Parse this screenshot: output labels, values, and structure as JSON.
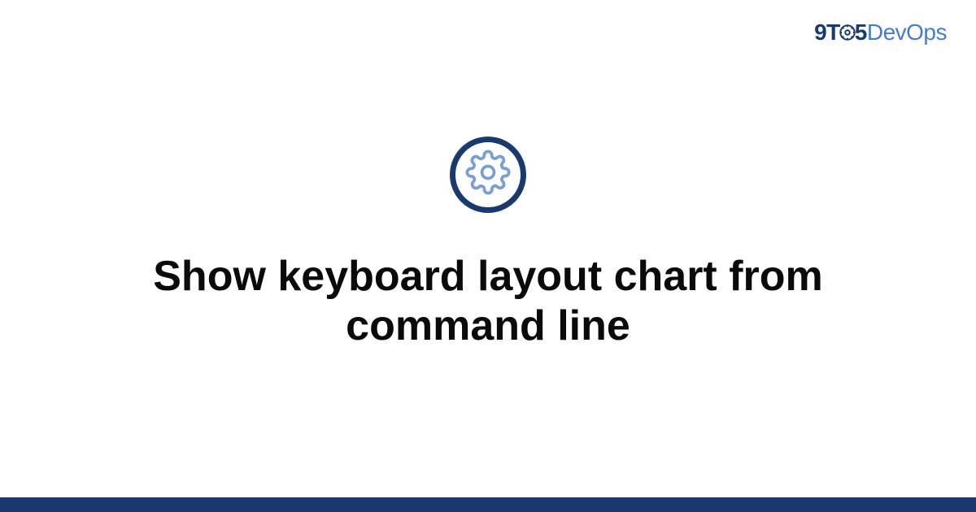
{
  "brand": {
    "prefix": "9T",
    "middle": "5",
    "suffix": "DevOps"
  },
  "heading": "Show keyboard layout chart from command line",
  "colors": {
    "darkBlue": "#1a3a6e",
    "lightBlue": "#4a7bc8",
    "iconBlue": "#7a9dd4"
  }
}
